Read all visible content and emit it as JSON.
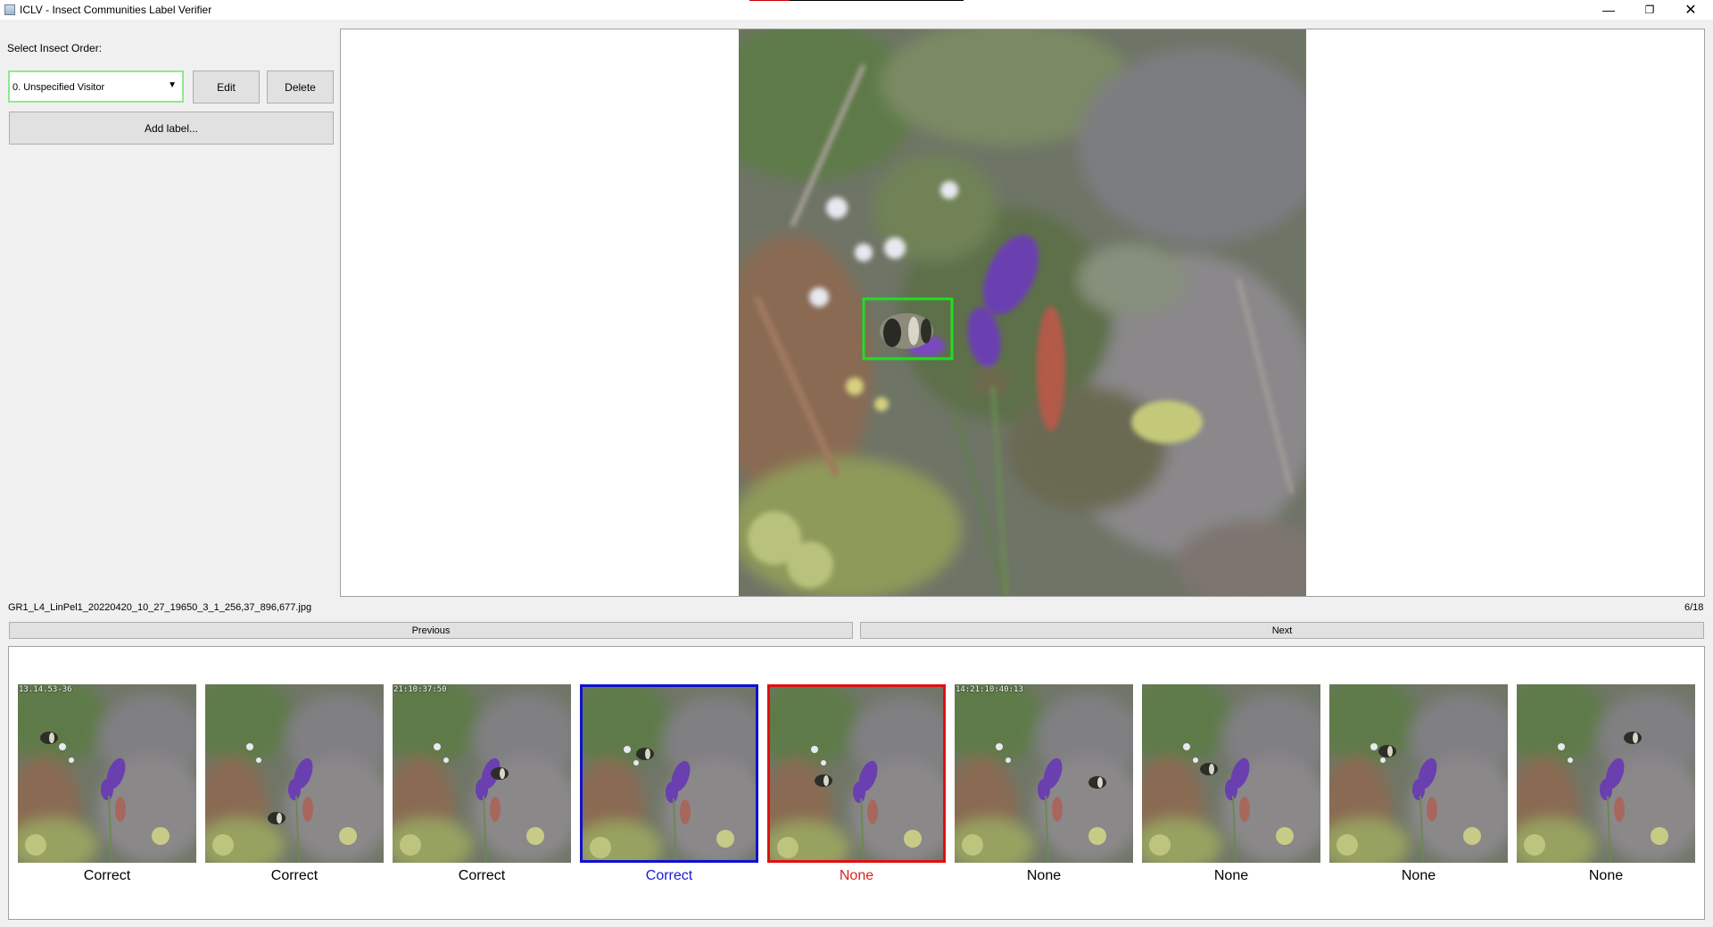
{
  "window": {
    "title": "ICLV - Insect Communities Label Verifier",
    "minimize_icon": "minimize-icon",
    "restore_icon": "restore-icon",
    "close_icon": "close-icon"
  },
  "left_panel": {
    "select_order_label": "Select Insect Order:",
    "combo_value": "0. Unspecified Visitor",
    "edit_label": "Edit",
    "delete_label": "Delete",
    "add_label": "Add label..."
  },
  "viewer": {
    "filename": "GR1_L4_LinPel1_20220420_10_27_19650_3_1_256,37_896,677.jpg",
    "counter": "6/18"
  },
  "nav": {
    "previous_label": "Previous",
    "next_label": "Next"
  },
  "colors": {
    "combo_border": "#90e890",
    "bbox": "#22dd22",
    "selected_blue": "#1010d0",
    "selected_red": "#e01010",
    "caption_blue": "#1a1ad8",
    "caption_red": "#e02020"
  },
  "thumbnails": [
    {
      "stamp": "13.14.53-36",
      "caption": "Correct",
      "state": "normal"
    },
    {
      "stamp": "",
      "caption": "Correct",
      "state": "normal"
    },
    {
      "stamp": "21:10:37:50",
      "caption": "Correct",
      "state": "normal"
    },
    {
      "stamp": "",
      "caption": "Correct",
      "state": "blue"
    },
    {
      "stamp": "",
      "caption": "None",
      "state": "red"
    },
    {
      "stamp": "14:21:10:40:13",
      "caption": "None",
      "state": "normal"
    },
    {
      "stamp": "",
      "caption": "None",
      "state": "normal"
    },
    {
      "stamp": "",
      "caption": "None",
      "state": "normal"
    },
    {
      "stamp": "",
      "caption": "None",
      "state": "normal"
    }
  ]
}
